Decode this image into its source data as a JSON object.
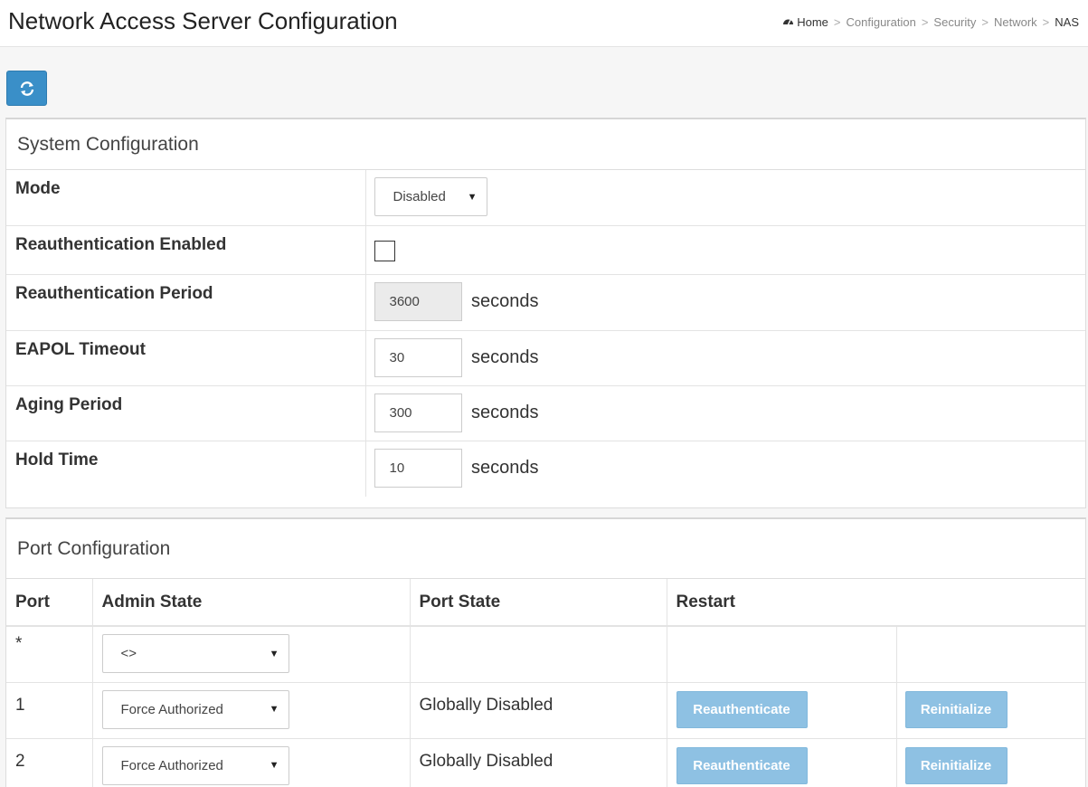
{
  "header": {
    "title": "Network Access Server Configuration",
    "breadcrumb": [
      "Home",
      "Configuration",
      "Security",
      "Network",
      "NAS"
    ]
  },
  "system": {
    "title": "System Configuration",
    "rows": [
      {
        "label": "Mode",
        "type": "select",
        "value": "Disabled"
      },
      {
        "label": "Reauthentication Enabled",
        "type": "checkbox",
        "checked": false
      },
      {
        "label": "Reauthentication Period",
        "type": "number",
        "value": "3600",
        "unit": "seconds",
        "disabled": true
      },
      {
        "label": "EAPOL Timeout",
        "type": "number",
        "value": "30",
        "unit": "seconds"
      },
      {
        "label": "Aging Period",
        "type": "number",
        "value": "300",
        "unit": "seconds"
      },
      {
        "label": "Hold Time",
        "type": "number",
        "value": "10",
        "unit": "seconds"
      }
    ]
  },
  "port": {
    "title": "Port Configuration",
    "headers": [
      "Port",
      "Admin State",
      "Port State",
      "Restart"
    ],
    "rows": [
      {
        "port": "*",
        "admin_state": "<>",
        "port_state": "",
        "reauth": "",
        "reinit": ""
      },
      {
        "port": "1",
        "admin_state": "Force Authorized",
        "port_state": "Globally Disabled",
        "reauth": "Reauthenticate",
        "reinit": "Reinitialize"
      },
      {
        "port": "2",
        "admin_state": "Force Authorized",
        "port_state": "Globally Disabled",
        "reauth": "Reauthenticate",
        "reinit": "Reinitialize"
      }
    ]
  }
}
